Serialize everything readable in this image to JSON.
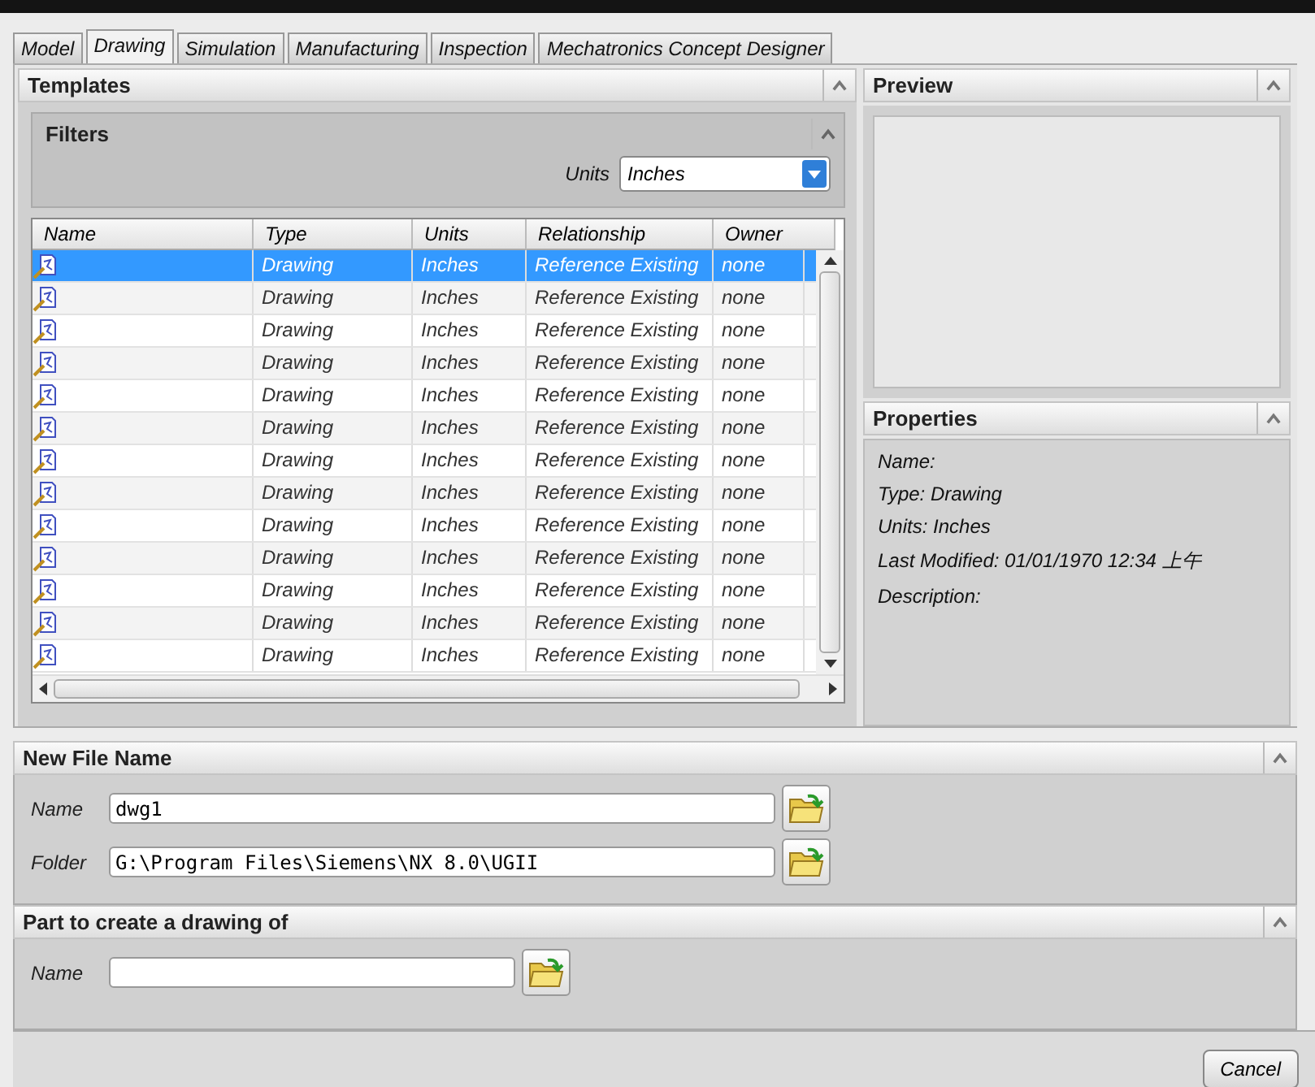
{
  "tabs": [
    {
      "label": "Model",
      "selected": false
    },
    {
      "label": "Drawing",
      "selected": true
    },
    {
      "label": "Simulation",
      "selected": false
    },
    {
      "label": "Manufacturing",
      "selected": false
    },
    {
      "label": "Inspection",
      "selected": false
    },
    {
      "label": "Mechatronics Concept Designer",
      "selected": false
    }
  ],
  "templates": {
    "title": "Templates",
    "filters": {
      "title": "Filters",
      "units_label": "Units",
      "units_value": "Inches"
    },
    "columns": [
      "Name",
      "Type",
      "Units",
      "Relationship",
      "Owner"
    ],
    "rows": [
      {
        "type": "Drawing",
        "units": "Inches",
        "relationship": "Reference Existing",
        "owner": "none",
        "selected": true
      },
      {
        "type": "Drawing",
        "units": "Inches",
        "relationship": "Reference Existing",
        "owner": "none",
        "selected": false
      },
      {
        "type": "Drawing",
        "units": "Inches",
        "relationship": "Reference Existing",
        "owner": "none",
        "selected": false
      },
      {
        "type": "Drawing",
        "units": "Inches",
        "relationship": "Reference Existing",
        "owner": "none",
        "selected": false
      },
      {
        "type": "Drawing",
        "units": "Inches",
        "relationship": "Reference Existing",
        "owner": "none",
        "selected": false
      },
      {
        "type": "Drawing",
        "units": "Inches",
        "relationship": "Reference Existing",
        "owner": "none",
        "selected": false
      },
      {
        "type": "Drawing",
        "units": "Inches",
        "relationship": "Reference Existing",
        "owner": "none",
        "selected": false
      },
      {
        "type": "Drawing",
        "units": "Inches",
        "relationship": "Reference Existing",
        "owner": "none",
        "selected": false
      },
      {
        "type": "Drawing",
        "units": "Inches",
        "relationship": "Reference Existing",
        "owner": "none",
        "selected": false
      },
      {
        "type": "Drawing",
        "units": "Inches",
        "relationship": "Reference Existing",
        "owner": "none",
        "selected": false
      },
      {
        "type": "Drawing",
        "units": "Inches",
        "relationship": "Reference Existing",
        "owner": "none",
        "selected": false
      },
      {
        "type": "Drawing",
        "units": "Inches",
        "relationship": "Reference Existing",
        "owner": "none",
        "selected": false
      },
      {
        "type": "Drawing",
        "units": "Inches",
        "relationship": "Reference Existing",
        "owner": "none",
        "selected": false
      }
    ]
  },
  "preview": {
    "title": "Preview"
  },
  "properties": {
    "title": "Properties",
    "lines": [
      "Name:",
      "Type: Drawing",
      "Units: Inches",
      "Last Modified: 01/01/1970 12:34 上午",
      "Description:"
    ]
  },
  "new_file_name": {
    "title": "New File Name",
    "fields": [
      {
        "label": "Name",
        "value": "dwg1"
      },
      {
        "label": "Folder",
        "value": "G:\\Program Files\\Siemens\\NX 8.0\\UGII"
      }
    ]
  },
  "part": {
    "title": "Part to create a drawing of",
    "fields": [
      {
        "label": "Name"
      }
    ]
  },
  "buttons": [
    "Cancel"
  ]
}
